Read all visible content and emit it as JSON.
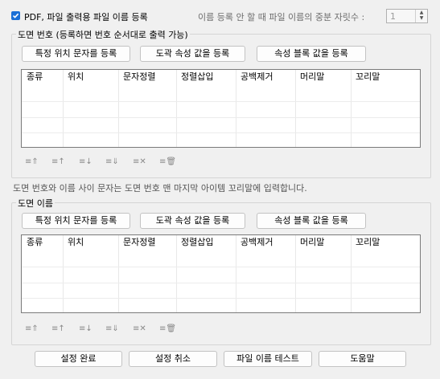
{
  "top": {
    "checkbox_label": "PDF, 파일 출력용 파일 이름 등록",
    "repeat_label": "이름 등록 안 할 때 파일 이름의 중분 자릿수 :",
    "repeat_value": "1"
  },
  "group1": {
    "title": "도면 번호 (등록하면 번호 순서대로 출력 가능)",
    "buttons": [
      "특정 위치 문자를 등록",
      "도곽 속성 값을 등록",
      "속성 블록 값을 등록"
    ],
    "columns": [
      "종류",
      "위치",
      "문자정렬",
      "정렬삽입",
      "공백제거",
      "머리말",
      "꼬리말"
    ]
  },
  "note": "도면 번호와 이름 사이 문자는 도면 번호 맨 마지막 아이템 꼬리말에 입력합니다.",
  "group2": {
    "title": "도면 이름",
    "buttons": [
      "특정 위치 문자를 등록",
      "도곽 속성 값을 등록",
      "속성 블록 값을 등록"
    ],
    "columns": [
      "종류",
      "위치",
      "문자정렬",
      "정렬삽입",
      "공백제거",
      "머리말",
      "꼬리말"
    ]
  },
  "toolbar": [
    "≡⇑",
    "≡↑",
    "≡↓",
    "≡⇓",
    "≡✕",
    "≡🗑"
  ],
  "footer": [
    "설정 완료",
    "설정 취소",
    "파일 이름 테스트",
    "도움말"
  ],
  "colors": {
    "checkbox_blue": "#1a6fd6",
    "toolbar_gray": "#8a8a8a"
  }
}
